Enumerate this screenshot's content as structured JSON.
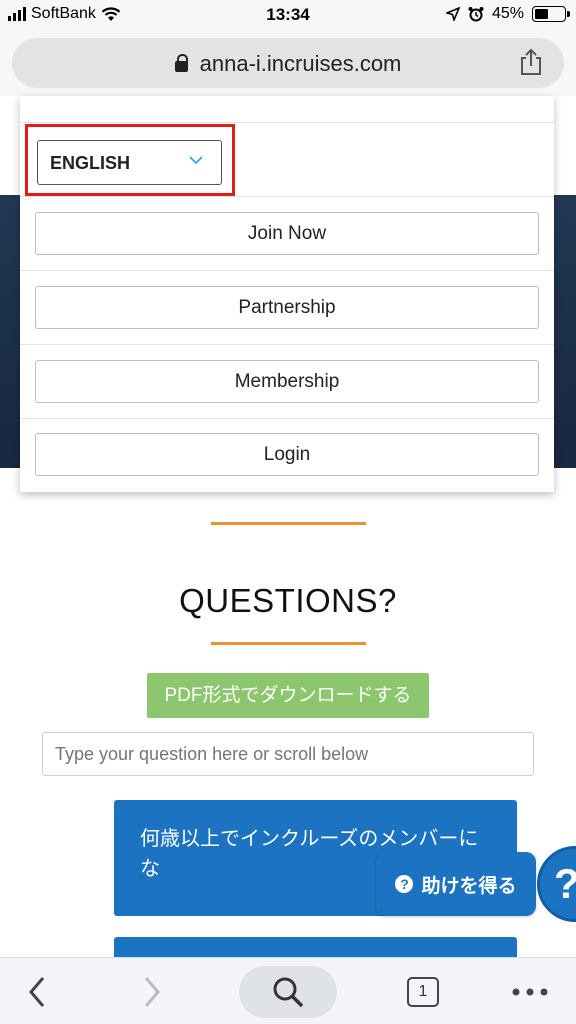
{
  "status_bar": {
    "carrier": "SoftBank",
    "time": "13:34",
    "battery": "45%",
    "battery_level": 0.45
  },
  "browser": {
    "url": "anna-i.incruises.com"
  },
  "menu": {
    "language": "ENGLISH",
    "items": [
      {
        "label": "Join Now"
      },
      {
        "label": "Partnership"
      },
      {
        "label": "Membership"
      },
      {
        "label": "Login"
      }
    ]
  },
  "questions": {
    "title": "QUESTIONS?",
    "pdf_button": "PDF形式でダウンロードする",
    "search_placeholder": "Type your question here or scroll below",
    "faq_items": [
      {
        "text": "何歳以上でインクルーズのメンバーにな"
      },
      {
        "text": ""
      }
    ]
  },
  "help_widget": {
    "label": "助けを得る",
    "bubble": "?"
  },
  "toolbar": {
    "tabs_count": "1"
  },
  "colors": {
    "accent_blue": "#1b73c2",
    "pdf_green": "#8cc66f",
    "orange": "#e89234",
    "highlight_red": "#e21b1b",
    "hero_navy": "#1c2f4a"
  },
  "icons": [
    "wifi-icon",
    "location-arrow-icon",
    "alarm-icon",
    "lock-icon",
    "share-icon",
    "chevron-down-icon",
    "hamburger-menu-icon",
    "question-circle-icon",
    "back-arrow-icon",
    "forward-arrow-icon",
    "search-icon",
    "tabs-icon",
    "more-icon"
  ]
}
